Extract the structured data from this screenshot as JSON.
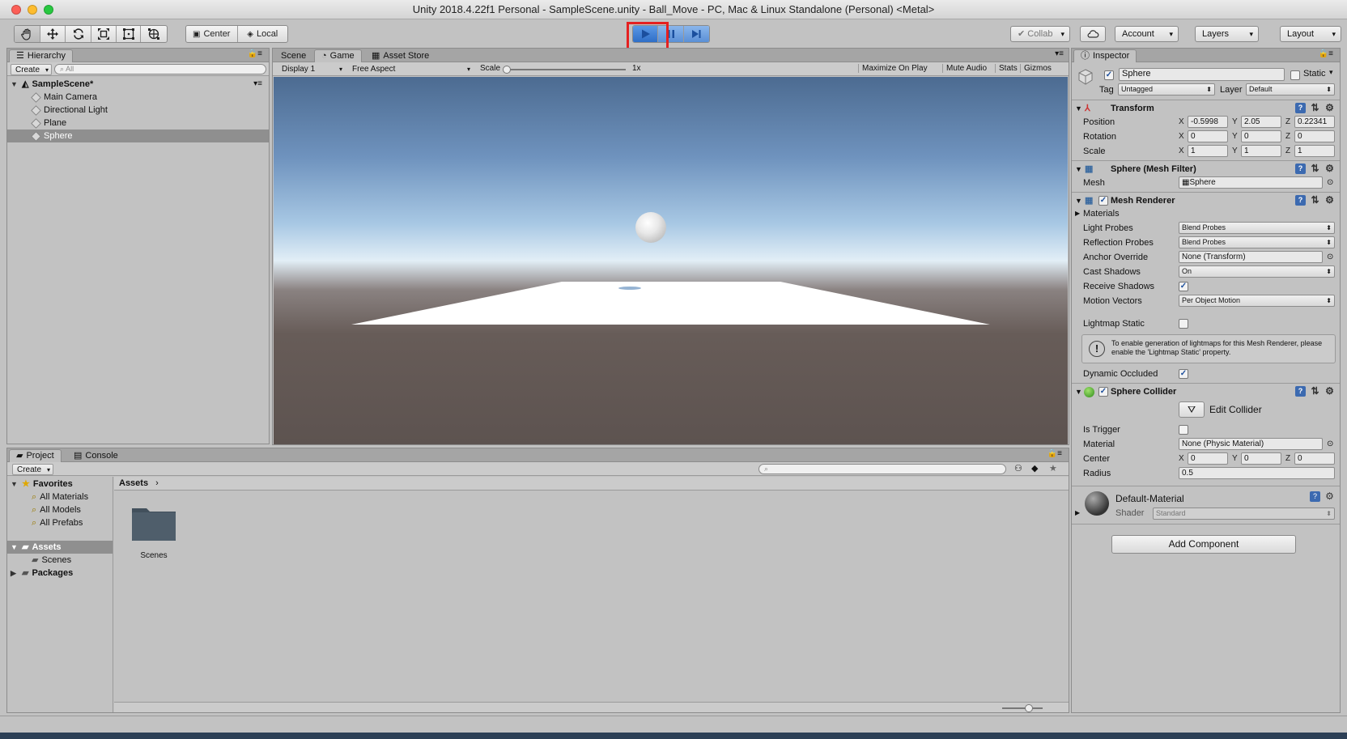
{
  "window": {
    "title": "Unity 2018.4.22f1 Personal - SampleScene.unity - Ball_Move - PC, Mac & Linux Standalone (Personal) <Metal>"
  },
  "toolbar": {
    "tools": [
      "hand-icon",
      "move-icon",
      "rotate-icon",
      "scale-icon",
      "rect-icon",
      "transform-icon"
    ],
    "pivot": "Center",
    "space": "Local",
    "collab": "Collab",
    "account": "Account",
    "layers": "Layers",
    "layout": "Layout"
  },
  "hierarchy": {
    "tab": "Hierarchy",
    "create": "Create",
    "search_placeholder": "All",
    "scene": "SampleScene*",
    "items": [
      "Main Camera",
      "Directional Light",
      "Plane",
      "Sphere"
    ]
  },
  "scene_tabs": {
    "scene": "Scene",
    "game": "Game",
    "asset_store": "Asset Store"
  },
  "game_bar": {
    "display": "Display 1",
    "aspect": "Free Aspect",
    "scale_label": "Scale",
    "scale_value": "1x",
    "maximize": "Maximize On Play",
    "mute": "Mute Audio",
    "stats": "Stats",
    "gizmos": "Gizmos"
  },
  "project": {
    "tab_project": "Project",
    "tab_console": "Console",
    "create": "Create",
    "favorites": "Favorites",
    "favorite_items": [
      "All Materials",
      "All Models",
      "All Prefabs"
    ],
    "assets": "Assets",
    "asset_children": [
      "Scenes"
    ],
    "packages": "Packages",
    "breadcrumb": "Assets",
    "folder": "Scenes"
  },
  "inspector": {
    "tab": "Inspector",
    "object_name": "Sphere",
    "static_label": "Static",
    "tag_label": "Tag",
    "tag_value": "Untagged",
    "layer_label": "Layer",
    "layer_value": "Default",
    "transform": {
      "title": "Transform",
      "position_label": "Position",
      "rotation_label": "Rotation",
      "scale_label": "Scale",
      "position": [
        "-0.5998",
        "2.05",
        "0.22341"
      ],
      "rotation": [
        "0",
        "0",
        "0"
      ],
      "scale": [
        "1",
        "1",
        "1"
      ]
    },
    "mesh_filter": {
      "title": "Sphere (Mesh Filter)",
      "mesh_label": "Mesh",
      "mesh_value": "Sphere"
    },
    "mesh_renderer": {
      "title": "Mesh Renderer",
      "materials_label": "Materials",
      "light_probes_label": "Light Probes",
      "light_probes": "Blend Probes",
      "reflection_probes_label": "Reflection Probes",
      "reflection_probes": "Blend Probes",
      "anchor_override_label": "Anchor Override",
      "anchor_override": "None (Transform)",
      "cast_shadows_label": "Cast Shadows",
      "cast_shadows": "On",
      "receive_shadows_label": "Receive Shadows",
      "motion_vectors_label": "Motion Vectors",
      "motion_vectors": "Per Object Motion",
      "lightmap_static_label": "Lightmap Static",
      "info_text": "To enable generation of lightmaps for this Mesh Renderer, please enable the 'Lightmap Static' property.",
      "dynamic_occluded_label": "Dynamic Occluded"
    },
    "sphere_collider": {
      "title": "Sphere Collider",
      "edit_collider": "Edit Collider",
      "is_trigger_label": "Is Trigger",
      "material_label": "Material",
      "material_value": "None (Physic Material)",
      "center_label": "Center",
      "center": [
        "0",
        "0",
        "0"
      ],
      "radius_label": "Radius",
      "radius_value": "0.5"
    },
    "material": {
      "name": "Default-Material",
      "shader_label": "Shader",
      "shader_value": "Standard"
    },
    "add_component": "Add Component"
  },
  "colors": {
    "play_highlight": "#e52020",
    "play_active": "#3c7fd6"
  }
}
